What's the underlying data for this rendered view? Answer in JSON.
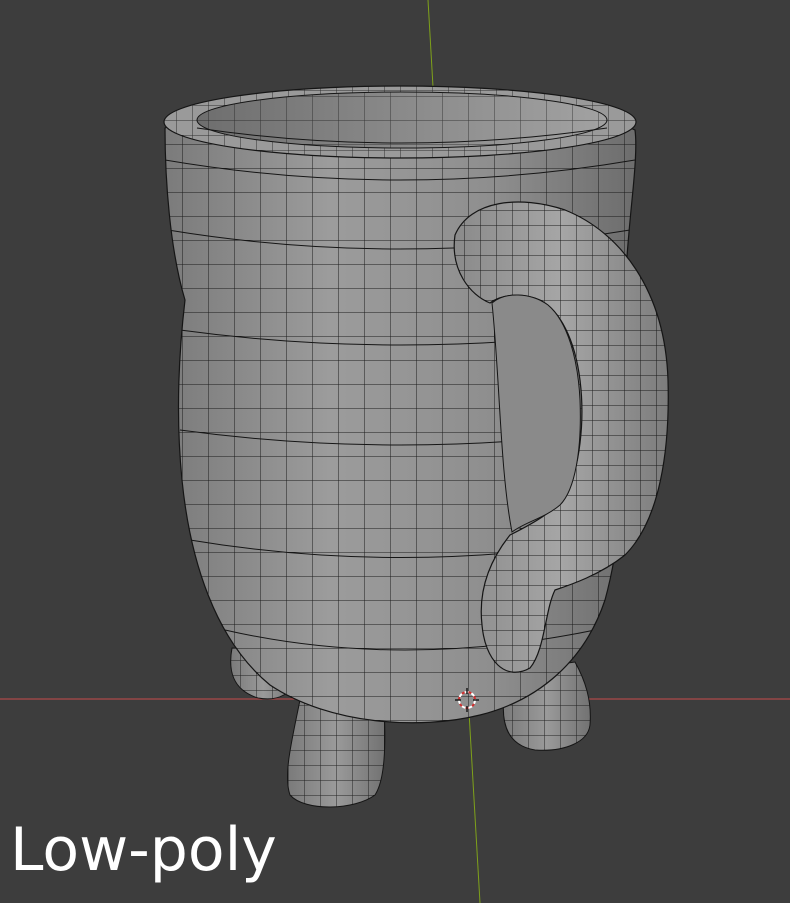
{
  "viewport": {
    "caption": "Low-poly",
    "background_color": "#3d3d3d",
    "mesh_color": "#8f8f8f",
    "wire_color": "#151515",
    "x_axis_color": "#c84a4a",
    "y_axis_color": "#7ea11a",
    "object": "mug-with-handle-and-three-legs",
    "cursor_icon": "3d-cursor-icon"
  }
}
